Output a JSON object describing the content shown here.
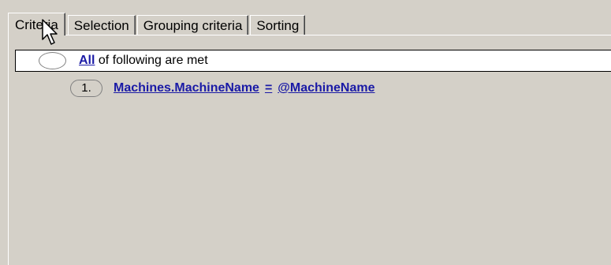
{
  "tabs": [
    {
      "label": "Criteria",
      "active": true
    },
    {
      "label": "Selection",
      "active": false
    },
    {
      "label": "Grouping criteria",
      "active": false
    },
    {
      "label": "Sorting",
      "active": false
    }
  ],
  "criteria": {
    "root": {
      "quantifier": "All",
      "suffix": " of following are met"
    },
    "conditions": [
      {
        "number": "1.",
        "field": "Machines.MachineName",
        "operator": "=",
        "value": "@MachineName"
      }
    ]
  },
  "colors": {
    "background": "#d4d0c8",
    "link": "#1a1aa6"
  },
  "icons": {
    "cursor": "mouse-pointer-icon"
  }
}
